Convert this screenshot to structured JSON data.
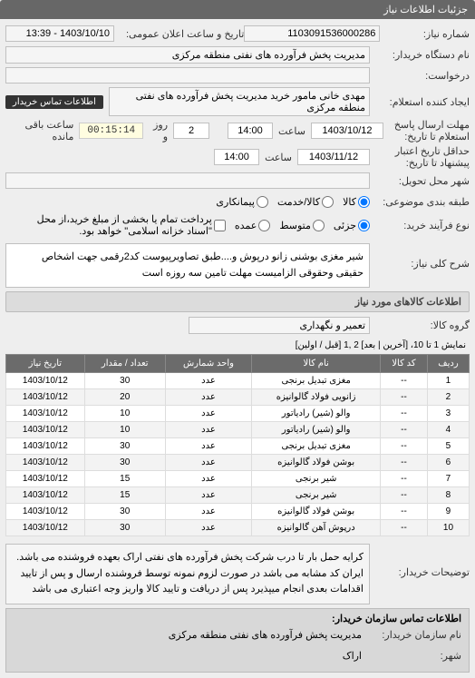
{
  "header": "جزئیات اطلاعات نیاز",
  "fields": {
    "req_num_lbl": "شماره نیاز:",
    "req_num": "1103091536000286",
    "announce_lbl": "تاریخ و ساعت اعلان عمومی:",
    "announce": "1403/10/10 - 13:39",
    "buyer_unit_lbl": "نام دستگاه خریدار:",
    "buyer_unit": "مدیریت پخش فرآورده های نفتی منطقه مرکزی",
    "request_lbl": "درخواست:",
    "creator_lbl": "ایجاد کننده استعلام:",
    "creator": "مهدی خانی مامور خرید مدیریت پخش فرآورده های نفتی منطقه مرکزی",
    "contact_btn": "اطلاعات تماس خریدار",
    "deadline_lbl": "مهلت ارسال پاسخ استعلام تا تاریخ:",
    "deadline_date": "1403/10/12",
    "time_lbl": "ساعت",
    "deadline_time": "14:00",
    "days": "2",
    "day_lbl": "روز و",
    "timer": "00:15:14",
    "remain": "ساعت باقی مانده",
    "min_valid_lbl": "حداقل تاریخ اعتبار پیشنهاد تا تاریخ:",
    "min_valid_date": "1403/11/12",
    "min_valid_time": "14:00",
    "city_lbl": "شهر محل تحویل:",
    "pkg_lbl": "طبقه بندی موضوعی:",
    "pkg_options": {
      "goods": "کالا",
      "service": "کالا/خدمت",
      "contract": "پیمانکاری"
    },
    "buy_type_lbl": "نوع فرآیند خرید:",
    "buy_options": {
      "low": "جزئی",
      "mid": "متوسط",
      "high": "عمده"
    },
    "pay_hint": "پرداخت تمام یا بخشی از مبلغ خرید،از محل \"اسناد خزانه اسلامی\" خواهد بود.",
    "desc_header_lbl": "شرح کلی نیاز:",
    "desc_text": "شیر مغزی بوشنی زانو درپوش و....طبق تصاویرپیوست کد2رقمی جهت اشخاص حقیقی وحقوقی الزامیست مهلت تامین سه روزه است",
    "items_section": "اطلاعات کالاهای مورد نیاز",
    "group_lbl": "گروه کالا:",
    "group": "تعمیر و نگهداری",
    "pager_text": "نمایش 1 تا 10، [آخرین | بعد] 2 ,1 [قبل / اولین]",
    "note_lbl": "توضیحات خریدار:",
    "note_text": "کرایه حمل بار تا درب شرکت پخش فرآورده های نفتی اراک بعهده فروشنده می باشد. ایران کد مشابه می باشد در صورت لزوم نمونه توسط فروشنده ارسال و پس از تایید اقدامات بعدی انجام میپذیرد پس از دریافت و تایید کالا واریز وجه اعتباری می باشد",
    "footer_title": "اطلاعات تماس سازمان خریدار:",
    "org_lbl": "نام سازمان خریدار:",
    "org": "مدیریت پخش فرآورده های نفتی منطقه مرکزی",
    "city2_lbl": "شهر:",
    "city2": "اراک"
  },
  "table": {
    "headers": [
      "ردیف",
      "کد کالا",
      "نام کالا",
      "واحد شمارش",
      "تعداد / مقدار",
      "تاریخ نیاز"
    ],
    "rows": [
      [
        "1",
        "--",
        "مغزی تبدیل برنجی",
        "عدد",
        "30",
        "1403/10/12"
      ],
      [
        "2",
        "--",
        "زانویی فولاد گالوانیزه",
        "عدد",
        "20",
        "1403/10/12"
      ],
      [
        "3",
        "--",
        "والو (شیر) رادیاتور",
        "عدد",
        "10",
        "1403/10/12"
      ],
      [
        "4",
        "--",
        "والو (شیر) رادیاتور",
        "عدد",
        "10",
        "1403/10/12"
      ],
      [
        "5",
        "--",
        "مغزی تبدیل برنجی",
        "عدد",
        "30",
        "1403/10/12"
      ],
      [
        "6",
        "--",
        "بوشن فولاد گالوانیزه",
        "عدد",
        "30",
        "1403/10/12"
      ],
      [
        "7",
        "--",
        "شیر برنجی",
        "عدد",
        "15",
        "1403/10/12"
      ],
      [
        "8",
        "--",
        "شیر برنجی",
        "عدد",
        "15",
        "1403/10/12"
      ],
      [
        "9",
        "--",
        "بوشن فولاد گالوانیزه",
        "عدد",
        "30",
        "1403/10/12"
      ],
      [
        "10",
        "--",
        "درپوش آهن گالوانیزه",
        "عدد",
        "30",
        "1403/10/12"
      ]
    ]
  }
}
